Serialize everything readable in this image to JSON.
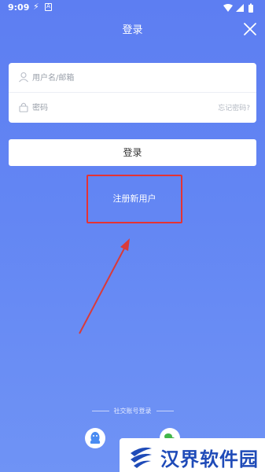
{
  "status_bar": {
    "time": "9:09",
    "icon_a": "A"
  },
  "header": {
    "title": "登录"
  },
  "form": {
    "username_placeholder": "用户名/邮箱",
    "password_placeholder": "密码",
    "forgot_label": "忘记密码?"
  },
  "login_button": "登录",
  "register_link": "注册新用户",
  "social": {
    "label": "社交账号登录"
  },
  "watermark": {
    "text": "汉界软件园"
  },
  "colors": {
    "background": "#6386f3",
    "highlight_box": "#e53333",
    "arrow": "#d93a3a",
    "qq": "#4a8cf2",
    "watermark_text": "#1f4bb8"
  },
  "icons": [
    "flash-icon",
    "a-icon",
    "wifi-icon",
    "signal-icon",
    "battery-icon",
    "close-icon",
    "user-icon",
    "lock-icon",
    "qq-icon",
    "wechat-icon",
    "watermark-logo"
  ]
}
